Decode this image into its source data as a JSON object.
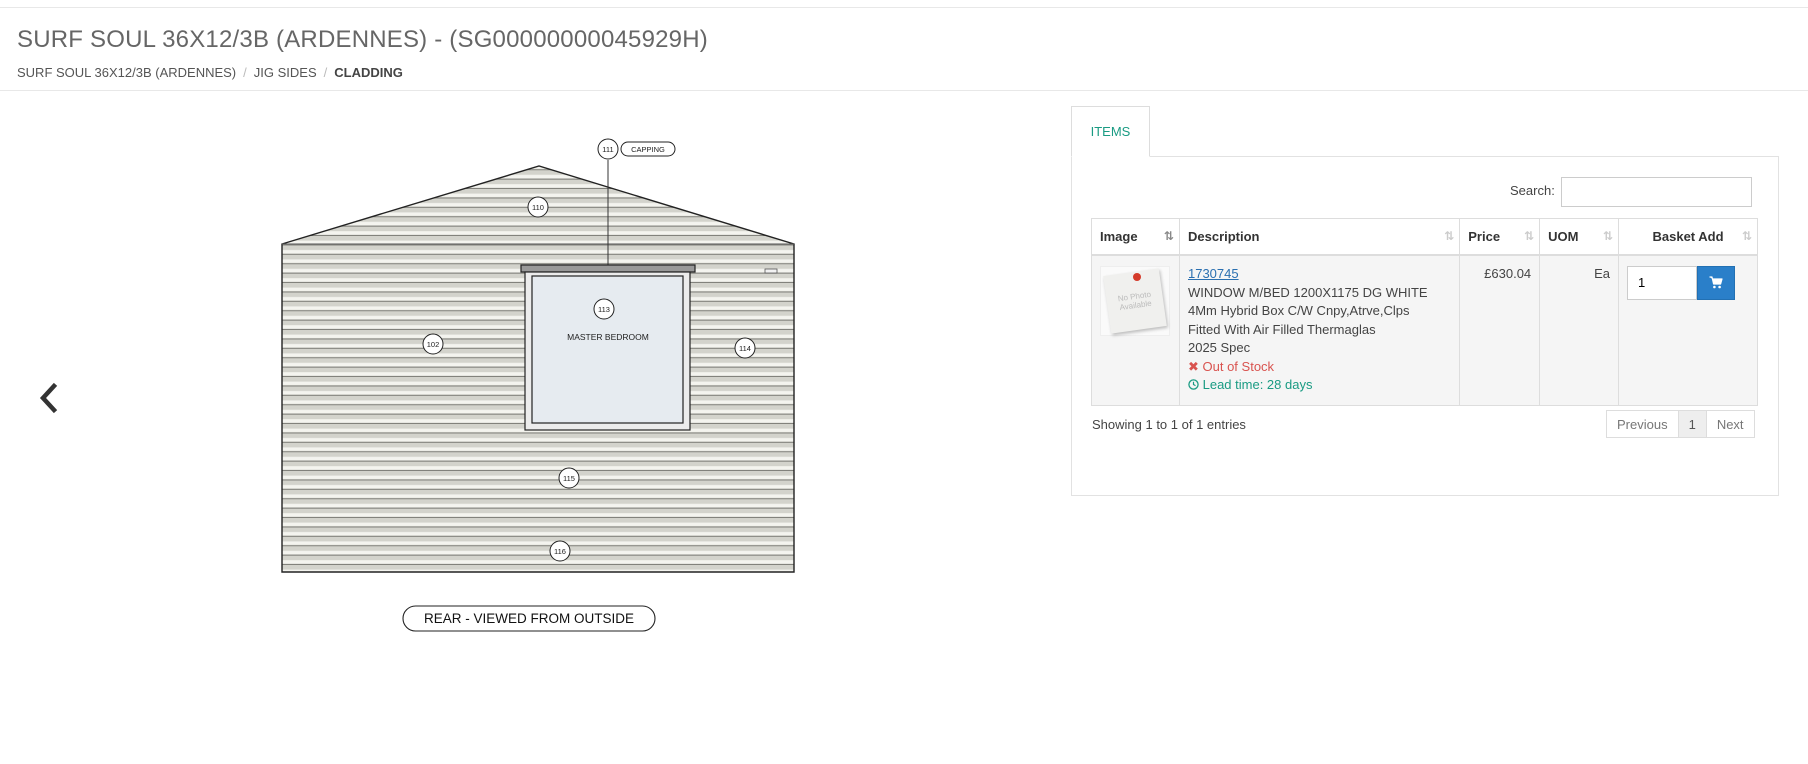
{
  "header": {
    "title": "SURF SOUL 36X12/3B (ARDENNES) - (SG00000000045929H)",
    "breadcrumb": [
      "SURF SOUL 36X12/3B (ARDENNES)",
      "JIG SIDES",
      "CLADDING"
    ]
  },
  "drawing": {
    "labels": {
      "capping": "CAPPING",
      "room": "MASTER BEDROOM",
      "view": "REAR - VIEWED FROM OUTSIDE"
    },
    "callouts": [
      "111",
      "110",
      "113",
      "102",
      "114",
      "115",
      "116"
    ]
  },
  "panel": {
    "tab": "ITEMS",
    "search_label": "Search:",
    "search_value": "",
    "columns": {
      "image": "Image",
      "description": "Description",
      "price": "Price",
      "uom": "UOM",
      "basket": "Basket Add"
    },
    "rows": [
      {
        "image_alt": "No Photo Available",
        "code": "1730745",
        "desc_lines": [
          "WINDOW M/BED 1200X1175 DG WHITE",
          "4Mm Hybrid Box C/W Cnpy,Atrve,Clps",
          "Fitted With Air Filled Thermaglas",
          "2025 Spec"
        ],
        "stock": "Out of Stock",
        "lead_time": "Lead time: 28 days",
        "price": "£630.04",
        "uom": "Ea",
        "qty": "1"
      }
    ],
    "info": "Showing 1 to 1 of 1 entries",
    "pager": {
      "previous": "Previous",
      "page": "1",
      "next": "Next"
    }
  },
  "colors": {
    "accent": "#1a9b83",
    "link": "#2a6fb0",
    "button": "#2a7fc9",
    "error": "#d9534f"
  }
}
